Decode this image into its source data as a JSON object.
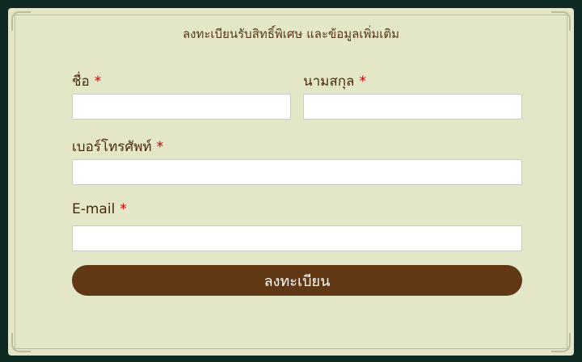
{
  "form": {
    "title": "ลงทะเบียนรับสิทธิ์พิเศษ และข้อมูลเพิ่มเติม",
    "required_mark": "*",
    "first_name": {
      "label": "ชื่อ",
      "value": "",
      "placeholder": ""
    },
    "last_name": {
      "label": "นามสกุล",
      "value": "",
      "placeholder": ""
    },
    "phone": {
      "label": "เบอร์โทรศัพท์",
      "value": "",
      "placeholder": ""
    },
    "email": {
      "label": "E-mail",
      "value": "",
      "placeholder": ""
    },
    "submit_label": "ลงทะเบียน"
  },
  "colors": {
    "background": "#0f2a22",
    "card": "#e3e6c7",
    "label": "#4a2a12",
    "required": "#c40000",
    "button": "#613814"
  }
}
